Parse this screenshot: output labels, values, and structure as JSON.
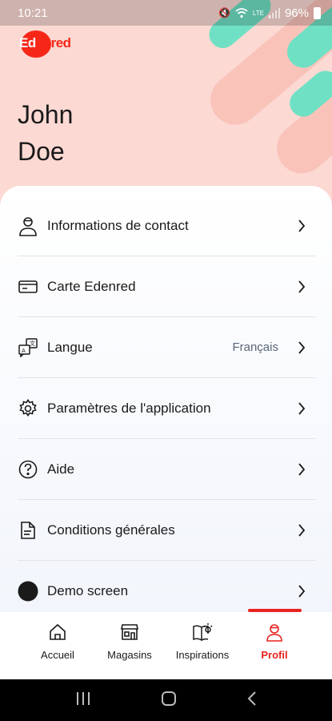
{
  "status_bar": {
    "time": "10:21",
    "battery": "96%",
    "network": "LTE"
  },
  "brand": {
    "logo_text_white": "Ed",
    "logo_text_red": "enred"
  },
  "profile": {
    "first_name": "John",
    "last_name": "Doe"
  },
  "menu": [
    {
      "label": "Informations de contact",
      "icon": "user-icon"
    },
    {
      "label": "Carte Edenred",
      "icon": "card-icon"
    },
    {
      "label": "Langue",
      "value": "Français",
      "icon": "language-icon"
    },
    {
      "label": "Paramètres de l'application",
      "icon": "gear-icon"
    },
    {
      "label": "Aide",
      "icon": "help-icon"
    },
    {
      "label": "Conditions générales",
      "icon": "document-icon"
    },
    {
      "label": "Demo screen",
      "icon": "circle-icon"
    }
  ],
  "bottom_nav": [
    {
      "label": "Accueil",
      "icon": "home-icon",
      "active": false
    },
    {
      "label": "Magasins",
      "icon": "store-icon",
      "active": false
    },
    {
      "label": "Inspirations",
      "icon": "inspiration-icon",
      "active": false
    },
    {
      "label": "Profil",
      "icon": "profile-icon",
      "active": true
    }
  ],
  "colors": {
    "accent": "#e8231f",
    "header_bg": "#fcd9d3",
    "mint": "#6fe0c4"
  }
}
